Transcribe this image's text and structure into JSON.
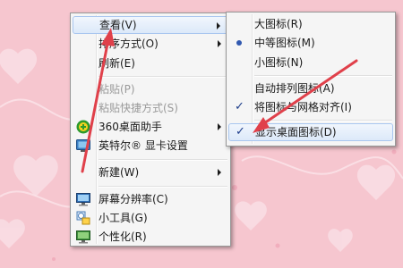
{
  "context_menu": {
    "items": [
      {
        "label": "查看(V)"
      },
      {
        "label": "排序方式(O)"
      },
      {
        "label": "刷新(E)"
      },
      {
        "label": "粘贴(P)"
      },
      {
        "label": "粘贴快捷方式(S)"
      },
      {
        "label": "360桌面助手"
      },
      {
        "label": "英特尔® 显卡设置"
      },
      {
        "label": "新建(W)"
      },
      {
        "label": "屏幕分辨率(C)"
      },
      {
        "label": "小工具(G)"
      },
      {
        "label": "个性化(R)"
      }
    ]
  },
  "view_submenu": {
    "items": [
      {
        "label": "大图标(R)"
      },
      {
        "label": "中等图标(M)",
        "selected": true
      },
      {
        "label": "小图标(N)"
      },
      {
        "label": "自动排列图标(A)"
      },
      {
        "label": "将图标与网格对齐(I)",
        "checked": true
      },
      {
        "label": "显示桌面图标(D)",
        "checked": true
      }
    ]
  },
  "colors": {
    "desktop_background": "#f6c6cf",
    "annotation_arrow": "#e0404a",
    "highlight_border": "#a9c6ef"
  }
}
